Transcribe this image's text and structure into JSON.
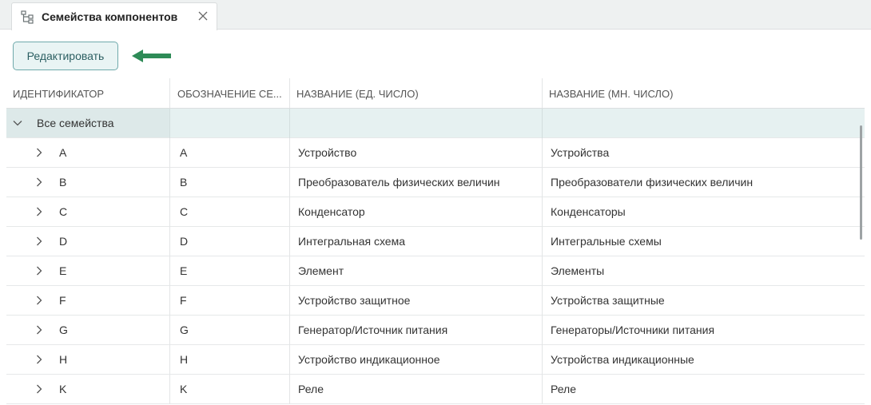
{
  "tab": {
    "title": "Семейства компонентов",
    "icon": "tree-structure-icon",
    "close_icon": "close-icon"
  },
  "toolbar": {
    "edit_label": "Редактировать",
    "accent": "#2e8b57"
  },
  "columns": [
    "ИДЕНТИФИКАТОР",
    "ОБОЗНАЧЕНИЕ СЕ...",
    "НАЗВАНИЕ (ЕД. ЧИСЛО)",
    "НАЗВАНИЕ (МН. ЧИСЛО)"
  ],
  "group": {
    "label": "Все семейства",
    "expanded": true
  },
  "rows": [
    {
      "id": "A",
      "code": "A",
      "singular": "Устройство",
      "plural": "Устройства"
    },
    {
      "id": "B",
      "code": "B",
      "singular": "Преобразователь физических величин",
      "plural": "Преобразователи физических величин"
    },
    {
      "id": "C",
      "code": "C",
      "singular": "Конденсатор",
      "plural": "Конденсаторы"
    },
    {
      "id": "D",
      "code": "D",
      "singular": "Интегральная схема",
      "plural": "Интегральные схемы"
    },
    {
      "id": "E",
      "code": "E",
      "singular": "Элемент",
      "plural": "Элементы"
    },
    {
      "id": "F",
      "code": "F",
      "singular": "Устройство защитное",
      "plural": "Устройства защитные"
    },
    {
      "id": "G",
      "code": "G",
      "singular": "Генератор/Источник питания",
      "plural": "Генераторы/Источники питания"
    },
    {
      "id": "H",
      "code": "H",
      "singular": "Устройство индикационное",
      "plural": "Устройства индикационные"
    },
    {
      "id": "K",
      "code": "K",
      "singular": "Реле",
      "plural": "Реле"
    }
  ]
}
